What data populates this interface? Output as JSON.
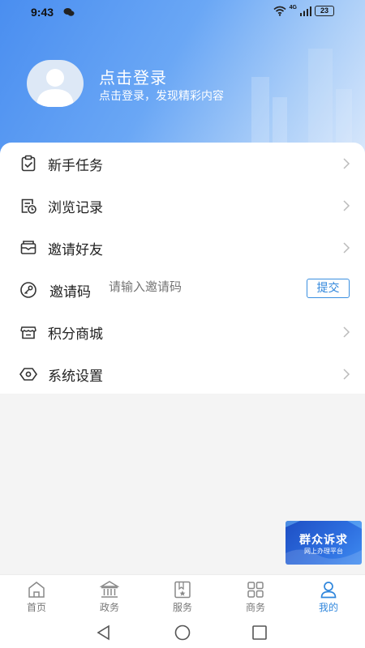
{
  "status_bar": {
    "time": "9:43",
    "network": "4G",
    "battery": "23"
  },
  "profile": {
    "title": "点击登录",
    "subtitle": "点击登录，发现精彩内容"
  },
  "menu": {
    "items": [
      {
        "label": "新手任务",
        "icon": "task-clipboard-icon"
      },
      {
        "label": "浏览记录",
        "icon": "history-doc-icon"
      },
      {
        "label": "邀请好友",
        "icon": "invite-envelope-icon"
      },
      {
        "label": "邀请码",
        "icon": "key-icon",
        "placeholder": "请输入邀请码",
        "button": "提交"
      },
      {
        "label": "积分商城",
        "icon": "store-icon"
      },
      {
        "label": "系统设置",
        "icon": "settings-hexagon-icon"
      }
    ]
  },
  "float_banner": {
    "title": "群众诉求",
    "subtitle": "网上办理平台"
  },
  "tabbar": {
    "tabs": [
      {
        "label": "首页",
        "icon": "home-icon",
        "active": false
      },
      {
        "label": "政务",
        "icon": "government-building-icon",
        "active": false
      },
      {
        "label": "服务",
        "icon": "service-bookmark-star-icon",
        "active": false
      },
      {
        "label": "商务",
        "icon": "grid-apps-icon",
        "active": false
      },
      {
        "label": "我的",
        "icon": "user-icon",
        "active": true
      }
    ]
  },
  "colors": {
    "accent": "#2f86dc",
    "header_start": "#4a8ef0",
    "header_end": "#d9e8fb"
  }
}
